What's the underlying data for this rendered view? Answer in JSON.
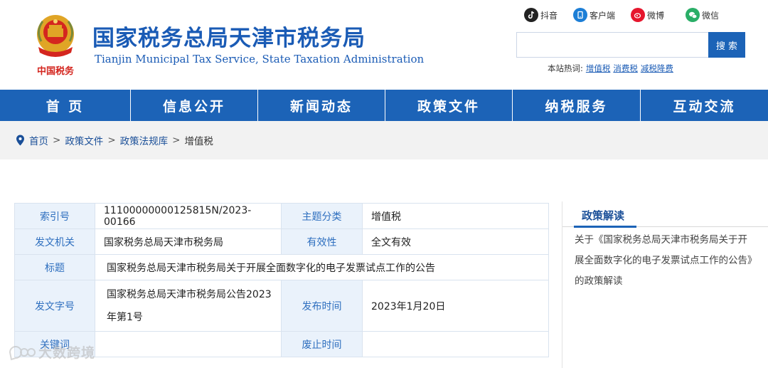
{
  "header": {
    "title_cn": "国家税务总局天津市税务局",
    "title_en": "Tianjin Municipal Tax Service, State Taxation Administration",
    "emblem_caption": "中国税务"
  },
  "social": [
    {
      "label": "抖音",
      "icon": "tiktok-icon",
      "color": "#222222"
    },
    {
      "label": "客户端",
      "icon": "client-app-icon",
      "color": "#1c7ed6"
    },
    {
      "label": "微博",
      "icon": "weibo-icon",
      "color": "#e6162d"
    },
    {
      "label": "微信",
      "icon": "wechat-icon",
      "color": "#2aae67"
    }
  ],
  "search": {
    "placeholder": "",
    "button_label": "搜 索",
    "hot_label": "本站热词:",
    "hot_words": [
      "增值税",
      "消费税",
      "减税降费"
    ]
  },
  "nav": [
    "首 页",
    "信息公开",
    "新闻动态",
    "政策文件",
    "纳税服务",
    "互动交流"
  ],
  "breadcrumb": {
    "items": [
      "首页",
      "政策文件",
      "政策法规库",
      "增值税"
    ],
    "separator": ">"
  },
  "info": {
    "index_label": "索引号",
    "index_value": "11100000000125815N/2023-00166",
    "topic_label": "主题分类",
    "topic_value": "增值税",
    "issuer_label": "发文机关",
    "issuer_value": "国家税务总局天津市税务局",
    "validity_label": "有效性",
    "validity_value": "全文有效",
    "title_label": "标题",
    "title_value": "国家税务总局天津市税务局关于开展全面数字化的电子发票试点工作的公告",
    "docno_label": "发文字号",
    "docno_value": "国家税务总局天津市税务局公告2023年第1号",
    "date_label": "发布时间",
    "date_value": "2023年1月20日",
    "keywords_label": "关键词",
    "keywords_value": "",
    "abolish_label": "废止时间",
    "abolish_value": ""
  },
  "side": {
    "title": "政策解读",
    "text": "关于《国家税务总局天津市税务局关于开展全面数字化的电子发票试点工作的公告》的政策解读"
  },
  "watermark": "大数跨境",
  "colors": {
    "brand_blue": "#1c63b7",
    "label_bg": "#eaf2fb",
    "label_text": "#2e6fbf",
    "emblem_red": "#d4261f",
    "emblem_gold": "#e0a526"
  }
}
